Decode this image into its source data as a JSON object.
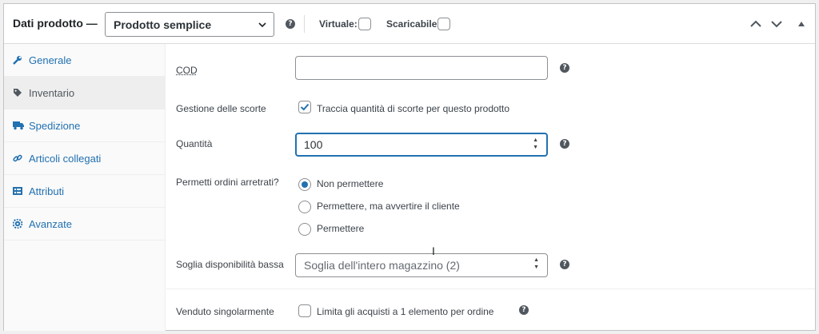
{
  "header": {
    "title": "Dati prodotto —",
    "product_type": "Prodotto semplice",
    "virtual_label": "Virtuale:",
    "downloadable_label": "Scaricabile:"
  },
  "sidebar": {
    "items": [
      {
        "label": "Generale",
        "icon": "wrench-icon"
      },
      {
        "label": "Inventario",
        "icon": "tag-icon"
      },
      {
        "label": "Spedizione",
        "icon": "truck-icon"
      },
      {
        "label": "Articoli collegati",
        "icon": "link-icon"
      },
      {
        "label": "Attributi",
        "icon": "list-icon"
      },
      {
        "label": "Avanzate",
        "icon": "gear-icon"
      }
    ],
    "active": "Inventario"
  },
  "inventory": {
    "sku_label": "COD",
    "sku_value": "",
    "stock_mgmt_label": "Gestione delle scorte",
    "stock_mgmt_text": "Traccia quantità di scorte per questo prodotto",
    "quantity_label": "Quantità",
    "quantity_value": "100",
    "backorders_label": "Permetti ordini arretrati?",
    "backorder_options": [
      "Non permettere",
      "Permettere, ma avvertire il cliente",
      "Permettere"
    ],
    "backorder_selected": "Non permettere",
    "low_stock_label": "Soglia disponibilità bassa",
    "low_stock_placeholder": "Soglia dell'intero magazzino (2)",
    "sold_individually_label": "Venduto singolarmente",
    "sold_individually_text": "Limita gli acquisti a 1 elemento per ordine"
  },
  "colors": {
    "accent": "#2271b1",
    "border": "#8c8f94",
    "text": "#3c434a"
  }
}
